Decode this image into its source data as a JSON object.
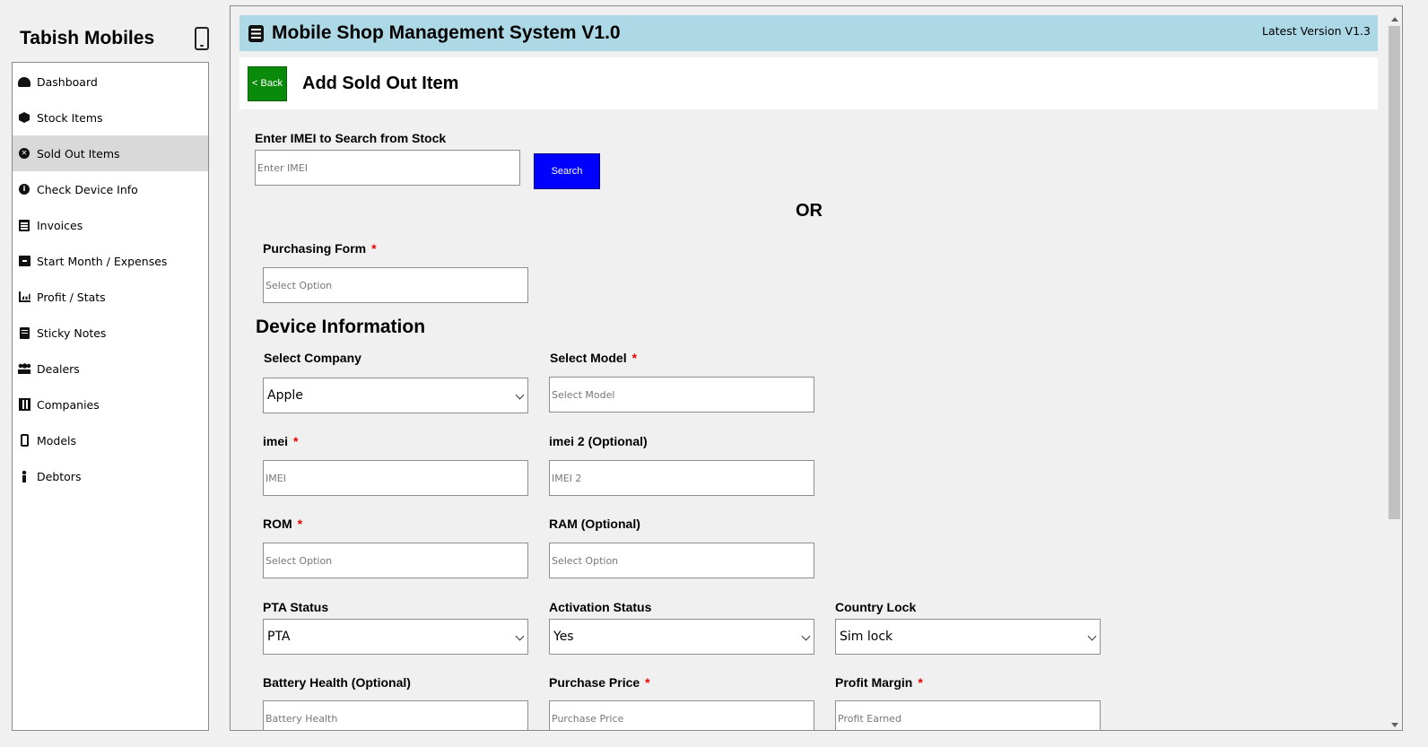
{
  "brand": {
    "title": "Tabish Mobiles",
    "icon": "mobile-phone-icon"
  },
  "sidebar": {
    "items": [
      {
        "label": "Dashboard",
        "icon": "gauge-icon",
        "active": false
      },
      {
        "label": "Stock Items",
        "icon": "box-icon",
        "active": false
      },
      {
        "label": "Sold Out Items",
        "icon": "x-circle-icon",
        "active": true
      },
      {
        "label": "Check Device Info",
        "icon": "info-icon",
        "active": false
      },
      {
        "label": "Invoices",
        "icon": "invoice-icon",
        "active": false
      },
      {
        "label": "Start Month / Expenses",
        "icon": "archive-icon",
        "active": false
      },
      {
        "label": "Profit / Stats",
        "icon": "chart-icon",
        "active": false
      },
      {
        "label": "Sticky Notes",
        "icon": "note-icon",
        "active": false
      },
      {
        "label": "Dealers",
        "icon": "people-icon",
        "active": false
      },
      {
        "label": "Companies",
        "icon": "building-icon",
        "active": false
      },
      {
        "label": "Models",
        "icon": "mobile-icon",
        "active": false
      },
      {
        "label": "Debtors",
        "icon": "person-icon",
        "active": false
      }
    ]
  },
  "header": {
    "title": "Mobile Shop Management System V1.0",
    "version": "Latest Version V1.3",
    "bg_color": "#add8e6"
  },
  "page": {
    "back_label": "< Back",
    "title": "Add Sold Out Item"
  },
  "search": {
    "label": "Enter IMEI to Search from Stock",
    "placeholder": "Enter IMEI",
    "button_label": "Search"
  },
  "or_text": "OR",
  "purchasing_form": {
    "label": "Purchasing Form",
    "placeholder": "Select Option"
  },
  "device_section_title": "Device Information",
  "fields": {
    "company": {
      "label": "Select Company",
      "value": "Apple"
    },
    "model": {
      "label": "Select Model",
      "placeholder": "Select Model"
    },
    "imei": {
      "label": "imei",
      "placeholder": "IMEI"
    },
    "imei2": {
      "label": "imei 2 (Optional)",
      "placeholder": "IMEI 2"
    },
    "rom": {
      "label": "ROM",
      "placeholder": "Select Option"
    },
    "ram": {
      "label": "RAM (Optional)",
      "placeholder": "Select Option"
    },
    "pta": {
      "label": "PTA Status",
      "value": "PTA"
    },
    "activation": {
      "label": "Activation Status",
      "value": "Yes"
    },
    "country_lock": {
      "label": "Country Lock",
      "value": "Sim lock"
    },
    "battery": {
      "label": "Battery Health (Optional)",
      "placeholder": "Battery Health"
    },
    "purchase_price": {
      "label": "Purchase Price",
      "placeholder": "Purchase Price"
    },
    "profit_margin": {
      "label": "Profit Margin",
      "placeholder": "Profit Earned"
    }
  },
  "required_mark": "*"
}
